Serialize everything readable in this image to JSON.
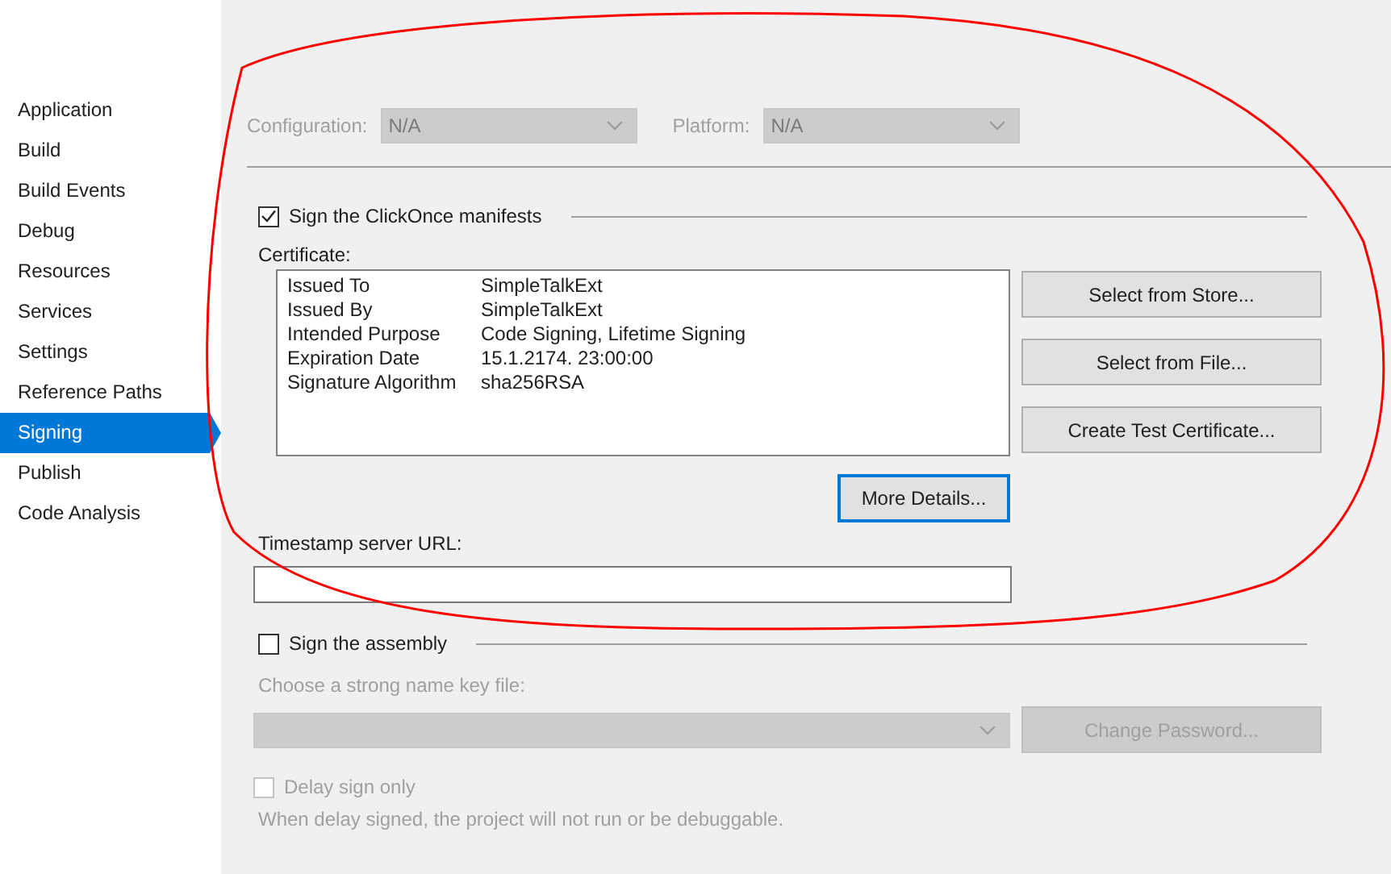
{
  "sidebar": {
    "items": [
      {
        "label": "Application",
        "selected": false
      },
      {
        "label": "Build",
        "selected": false
      },
      {
        "label": "Build Events",
        "selected": false
      },
      {
        "label": "Debug",
        "selected": false
      },
      {
        "label": "Resources",
        "selected": false
      },
      {
        "label": "Services",
        "selected": false
      },
      {
        "label": "Settings",
        "selected": false
      },
      {
        "label": "Reference Paths",
        "selected": false
      },
      {
        "label": "Signing",
        "selected": true
      },
      {
        "label": "Publish",
        "selected": false
      },
      {
        "label": "Code Analysis",
        "selected": false
      }
    ]
  },
  "configuration": {
    "label": "Configuration:",
    "value": "N/A",
    "disabled": true
  },
  "platform": {
    "label": "Platform:",
    "value": "N/A",
    "disabled": true
  },
  "sign_manifests": {
    "label": "Sign the ClickOnce manifests",
    "checked": true
  },
  "certificate": {
    "label": "Certificate:",
    "details": [
      {
        "name": "Issued To",
        "value": "SimpleTalkExt"
      },
      {
        "name": "Issued By",
        "value": "SimpleTalkExt"
      },
      {
        "name": "Intended Purpose",
        "value": "Code Signing, Lifetime Signing"
      },
      {
        "name": "Expiration Date",
        "value": "15.1.2174. 23:00:00"
      },
      {
        "name": "Signature Algorithm",
        "value": "sha256RSA"
      }
    ]
  },
  "certificate_buttons": [
    "Select from Store...",
    "Select from File...",
    "Create Test Certificate..."
  ],
  "more_details_button": {
    "label": "More Details...",
    "focused": true
  },
  "timestamp": {
    "label": "Timestamp server URL:"
  },
  "sign_assembly": {
    "label": "Sign the assembly",
    "checked": false
  },
  "key_file": {
    "label": "Choose a strong name key file:",
    "disabled": true
  },
  "change_password_button": {
    "label": "Change Password...",
    "disabled": true
  },
  "delay_sign": {
    "label": "Delay sign only",
    "checked": false,
    "disabled": true
  },
  "note": "When delay signed, the project will not run or be debuggable."
}
